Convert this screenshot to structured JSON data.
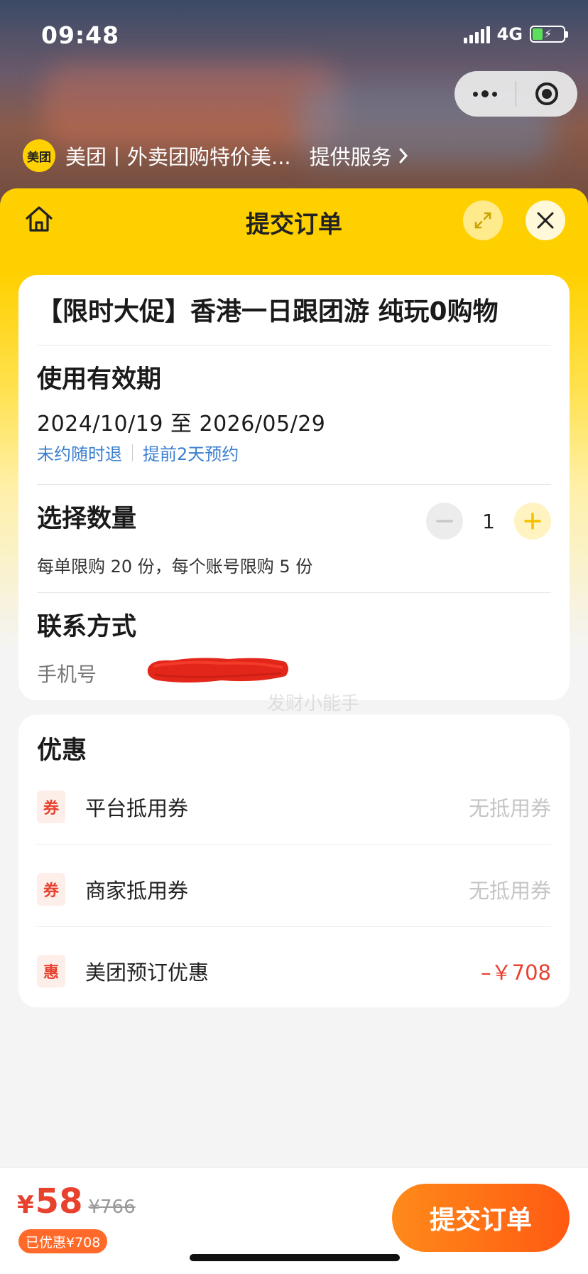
{
  "status_bar": {
    "time": "09:48",
    "network": "4G"
  },
  "service_bar": {
    "logo_text": "美团",
    "name": "美团丨外卖团购特价美...",
    "link_label": "提供服务"
  },
  "header": {
    "title": "提交订单"
  },
  "product": {
    "title": "【限时大促】香港一日跟团游 纯玩0购物"
  },
  "validity": {
    "label": "使用有效期",
    "dates": "2024/10/19 至 2026/05/29",
    "tags": [
      "未约随时退",
      "提前2天预约"
    ]
  },
  "quantity": {
    "label": "选择数量",
    "value": "1",
    "limit_text": "每单限购 20 份，每个账号限购 5 份"
  },
  "contact": {
    "label": "联系方式",
    "phone_label": "手机号"
  },
  "watermark": "发财小能手",
  "promotions": {
    "title": "优惠",
    "rows": [
      {
        "badge": "券",
        "name": "平台抵用券",
        "value": "无抵用券"
      },
      {
        "badge": "券",
        "name": "商家抵用券",
        "value": "无抵用券"
      },
      {
        "badge": "惠",
        "name": "美团预订优惠",
        "value": "–￥708"
      }
    ]
  },
  "footer": {
    "currency": "¥",
    "price": "58",
    "original_price": "¥766",
    "saved": "已优惠¥708",
    "submit_label": "提交订单"
  },
  "colors": {
    "brand_yellow": "#ffd000",
    "accent_red": "#e8412e",
    "link_blue": "#3a7fd0",
    "button_orange": "#ff6a1a"
  },
  "icons": [
    "home-icon",
    "expand-icon",
    "close-icon",
    "minus-icon",
    "plus-icon",
    "chevron-right-icon",
    "more-icon",
    "target-icon"
  ]
}
